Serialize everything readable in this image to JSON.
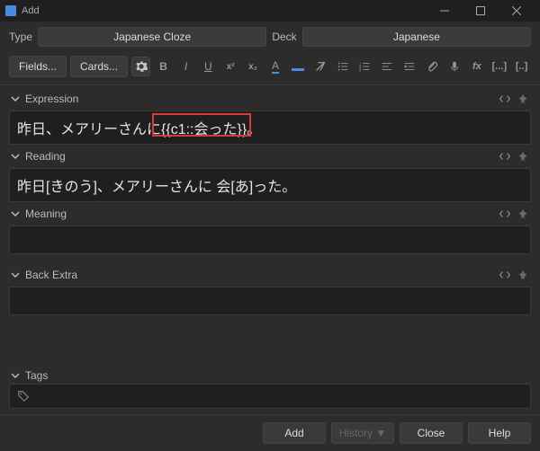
{
  "window": {
    "title": "Add"
  },
  "typebar": {
    "type_label": "Type",
    "type_value": "Japanese Cloze",
    "deck_label": "Deck",
    "deck_value": "Japanese"
  },
  "toolbar": {
    "fields_label": "Fields...",
    "cards_label": "Cards..."
  },
  "fields": {
    "expression": {
      "label": "Expression",
      "value": "昨日、メアリーさんに{{c1::会った}}。"
    },
    "reading": {
      "label": "Reading",
      "value": "昨日[きのう]、メアリーさんに 会[あ]った。"
    },
    "meaning": {
      "label": "Meaning",
      "value": ""
    },
    "back_extra": {
      "label": "Back Extra",
      "value": ""
    }
  },
  "tags": {
    "label": "Tags"
  },
  "bottom": {
    "add": "Add",
    "history": "History ▼",
    "close": "Close",
    "help": "Help"
  }
}
